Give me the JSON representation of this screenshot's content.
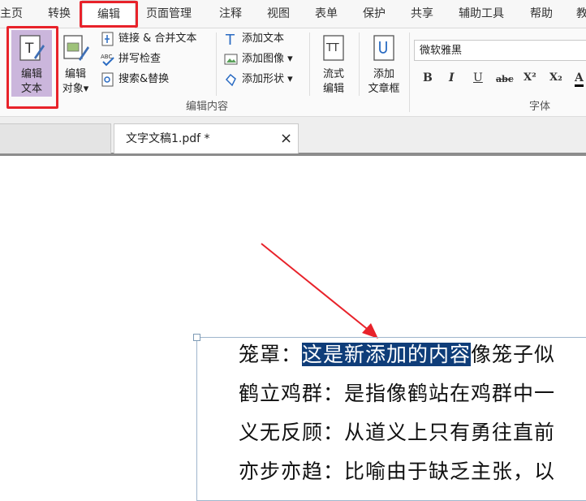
{
  "menu": {
    "items": [
      "主页",
      "转换",
      "编辑",
      "页面管理",
      "注释",
      "视图",
      "表单",
      "保护",
      "共享",
      "辅助工具",
      "帮助",
      "教"
    ],
    "active": "编辑"
  },
  "ribbon": {
    "edit_text": {
      "line1": "编辑",
      "line2": "文本"
    },
    "edit_object": {
      "line1": "编辑",
      "line2": "对象▾"
    },
    "link_merge": "链接 & 合并文本",
    "spell_check": "拼写检查",
    "search_replace": "搜索&替换",
    "add_text": "添加文本",
    "add_image": "添加图像 ▾",
    "add_shape": "添加形状 ▾",
    "flow_edit": {
      "line1": "流式",
      "line2": "编辑"
    },
    "add_article": {
      "line1": "添加",
      "line2": "文章框"
    },
    "group_edit_content": "编辑内容",
    "font_name": "微软雅黑",
    "group_font": "字体",
    "format_buttons": [
      "B",
      "I",
      "U",
      "abc",
      "X²",
      "X₂",
      "A"
    ]
  },
  "tabs": {
    "doc_title": "文字文稿1.pdf *",
    "close": "×"
  },
  "document": {
    "line1_prefix": "笼罩：",
    "line1_highlight": "这是新添加的内容",
    "line1_suffix": "像笼子似",
    "line2": "鹤立鸡群：是指像鹤站在鸡群中一",
    "line3": "义无反顾：从道义上只有勇往直前",
    "line4": "亦步亦趋：比喻由于缺乏主张，以"
  },
  "colors": {
    "accent_red": "#e8222a",
    "selection": "#0f3d79"
  }
}
